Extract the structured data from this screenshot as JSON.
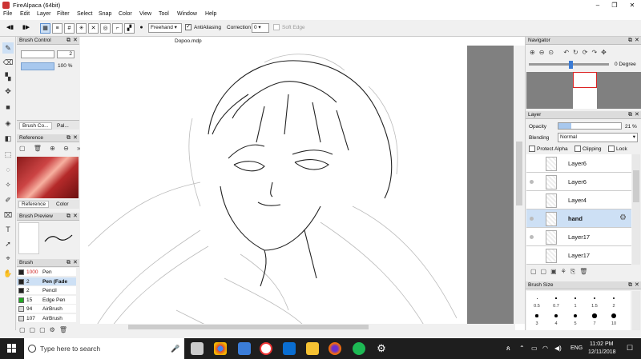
{
  "window": {
    "title": "FireAlpaca (64bit)",
    "minimize": "–",
    "maximize": "❐",
    "close": "✕"
  },
  "menu": [
    "File",
    "Edit",
    "Layer",
    "Filter",
    "Select",
    "Snap",
    "Color",
    "View",
    "Tool",
    "Window",
    "Help"
  ],
  "toolbar": {
    "mode_value": "Freehand",
    "antialias_label": "AntiAliasing",
    "antialias_checked": true,
    "correction_label": "Correction",
    "correction_value": "0",
    "soft_edge_label": "Soft Edge"
  },
  "canvas": {
    "doc_title": "Dopoo.mdp"
  },
  "brush_control": {
    "title": "Brush Control",
    "size_value": "2",
    "opacity_value": "100 %"
  },
  "tabs_top": {
    "brush_control_tab": "Brush Co...",
    "palette_tab": "Pal..."
  },
  "reference": {
    "title": "Reference",
    "tab_reference": "Reference",
    "tab_color": "Color"
  },
  "brush_preview": {
    "title": "Brush Preview"
  },
  "brush": {
    "title": "Brush",
    "items": [
      {
        "num": "1000",
        "name": "Pen",
        "color": "#222222",
        "num_color": "#cc2222"
      },
      {
        "num": "2",
        "name": "Pen (Fade",
        "color": "#222222",
        "selected": true
      },
      {
        "num": "2",
        "name": "Pencil",
        "color": "#222222"
      },
      {
        "num": "15",
        "name": "Edge Pen",
        "color": "#22aa22"
      },
      {
        "num": "94",
        "name": "AirBrush",
        "color": "#dddddd"
      },
      {
        "num": "107",
        "name": "AirBrush",
        "color": "#dddddd"
      }
    ]
  },
  "navigator": {
    "title": "Navigator",
    "degree": "0 Degree"
  },
  "layer": {
    "title": "Layer",
    "opacity_label": "Opacity",
    "opacity_value": "21 %",
    "blending_label": "Blending",
    "blending_value": "Normal",
    "protect_alpha": "Protect Alpha",
    "clipping": "Clipping",
    "lock": "Lock",
    "layers": [
      "Layer6",
      "Layer6",
      "Layer4",
      "hand",
      "Layer17",
      "Layer17"
    ],
    "active_index": 3
  },
  "brush_size": {
    "title": "Brush Size",
    "labels": [
      "0.5",
      "0.7",
      "1",
      "1.5",
      "2",
      "3",
      "4",
      "5",
      "7",
      "10"
    ]
  },
  "taskbar": {
    "search_placeholder": "Type here to search",
    "time": "11:02 PM",
    "date": "12/11/2018",
    "lang": "ENG"
  }
}
